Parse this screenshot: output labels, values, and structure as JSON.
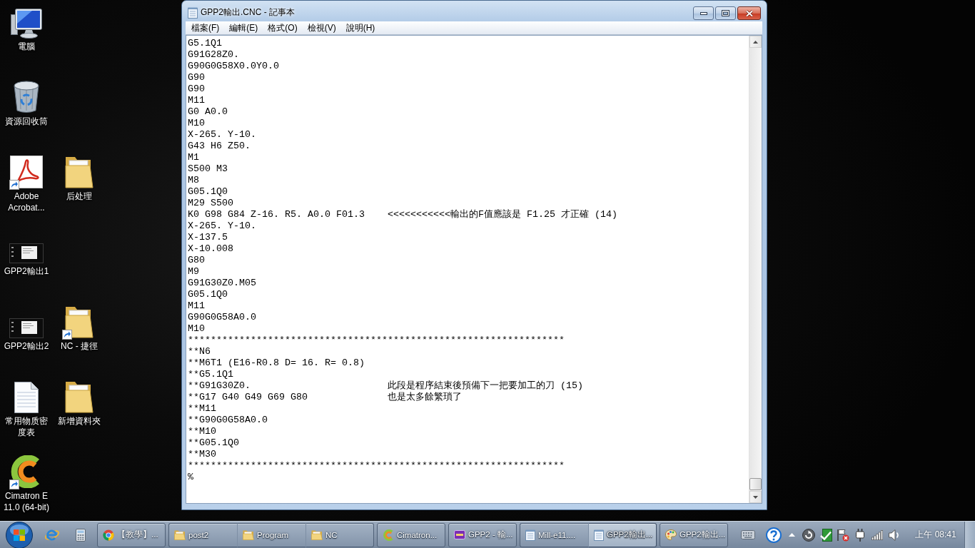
{
  "desktop": {
    "rows": [
      {
        "icons": [
          {
            "label": "電腦",
            "kind": "computer",
            "shortcut": false
          }
        ]
      },
      {
        "icons": [
          {
            "label": "資源回收筒",
            "kind": "recycle-bin",
            "shortcut": false
          }
        ]
      },
      {
        "icons": [
          {
            "label": "Adobe Acrobat...",
            "kind": "pdf",
            "shortcut": true
          },
          {
            "label": "后处理",
            "kind": "folder",
            "shortcut": false
          }
        ]
      },
      {
        "icons": [
          {
            "label": "GPP2輸出1",
            "kind": "thumbnail",
            "shortcut": false
          }
        ]
      },
      {
        "icons": [
          {
            "label": "GPP2輸出2",
            "kind": "thumbnail",
            "shortcut": false
          },
          {
            "label": "NC - 捷徑",
            "kind": "folder",
            "shortcut": true
          }
        ]
      },
      {
        "icons": [
          {
            "label": "常用物质密度表",
            "kind": "document",
            "shortcut": false
          },
          {
            "label": "新增資料夾",
            "kind": "folder",
            "shortcut": false
          }
        ]
      },
      {
        "icons": [
          {
            "label": "Cimatron E 11.0 (64-bit)",
            "kind": "cad",
            "shortcut": true
          }
        ]
      }
    ]
  },
  "window": {
    "title": "GPP2輸出.CNC - 記事本",
    "menu": [
      "檔案(F)",
      "編輯(E)",
      "格式(O)",
      "檢視(V)",
      "說明(H)"
    ],
    "text_lines": [
      "G5.1Q1",
      "G91G28Z0.",
      "G90G0G58X0.0Y0.0",
      "G90",
      "G90",
      "M11",
      "G0 A0.0",
      "M10",
      "X-265. Y-10.",
      "G43 H6 Z50.",
      "M1",
      "S500 M3",
      "M8",
      "G05.1Q0",
      "M29 S500",
      "K0 G98 G84 Z-16. R5. A0.0 F01.3    <<<<<<<<<<<輸出的F值應該是 F1.25 才正確 (14)",
      "X-265. Y-10.",
      "X-137.5",
      "X-10.008",
      "G80",
      "M9",
      "G91G30Z0.M05",
      "G05.1Q0",
      "M11",
      "G90G0G58A0.0",
      "M10",
      "******************************************************************",
      "**N6",
      "**M6T1 (E16-R0.8 D= 16. R= 0.8)",
      "**G5.1Q1",
      "**G91G30Z0.                        此段是程序結束後預備下一把要加工的刀 (15)",
      "**G17 G40 G49 G69 G80              也是太多餘繁瑣了",
      "**M11",
      "**G90G0G58A0.0",
      "**M10",
      "**G05.1Q0",
      "**M30",
      "******************************************************************",
      "%"
    ]
  },
  "taskbar": {
    "groups": [
      {
        "buttons": [
          {
            "label": "【教學】...",
            "kind": "browser",
            "selected": false
          }
        ]
      },
      {
        "buttons": [
          {
            "label": "post2",
            "kind": "folder",
            "selected": false
          },
          {
            "label": "Program",
            "kind": "folder",
            "selected": false
          },
          {
            "label": "NC",
            "kind": "folder",
            "selected": false
          }
        ]
      },
      {
        "buttons": [
          {
            "label": "Cimatron...",
            "kind": "cad",
            "selected": false
          }
        ]
      },
      {
        "buttons": [
          {
            "label": "GPP2 - 輸...",
            "kind": "post",
            "selected": false
          }
        ]
      },
      {
        "buttons": [
          {
            "label": "Mill-e11....",
            "kind": "notepad",
            "selected": false
          },
          {
            "label": "GPP2輸出...",
            "kind": "notepad",
            "selected": true
          }
        ]
      },
      {
        "buttons": [
          {
            "label": "GPP2輸出...",
            "kind": "paint",
            "selected": false
          }
        ]
      }
    ],
    "clock": "上午 08:41"
  }
}
